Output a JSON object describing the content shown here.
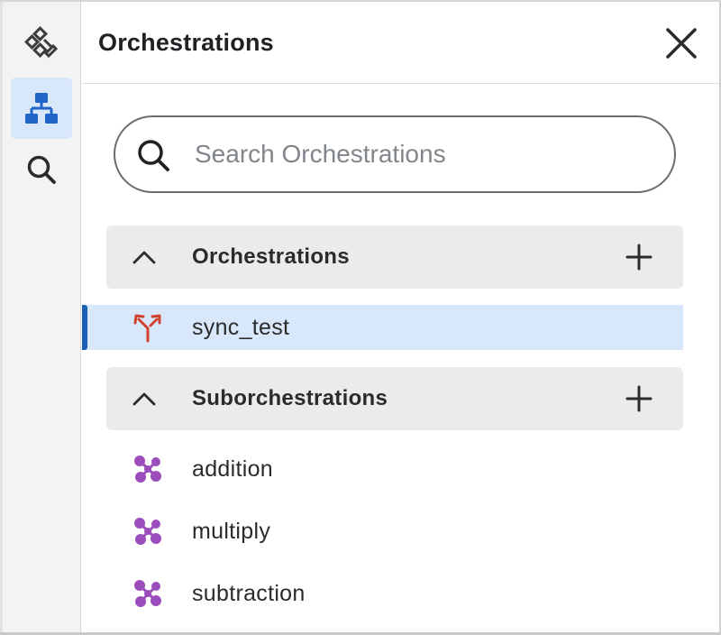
{
  "rail": {
    "items": [
      {
        "icon": "tools-icon",
        "active": false
      },
      {
        "icon": "hierarchy-icon",
        "active": true
      },
      {
        "icon": "search-icon",
        "active": false
      }
    ]
  },
  "panel": {
    "title": "Orchestrations",
    "close_icon": "close-icon"
  },
  "search": {
    "placeholder": "Search Orchestrations",
    "value": ""
  },
  "groups": [
    {
      "title": "Orchestrations",
      "expanded": true,
      "items": [
        {
          "label": "sync_test",
          "icon": "merge-arrows-icon",
          "selected": true
        }
      ]
    },
    {
      "title": "Suborchestrations",
      "expanded": true,
      "items": [
        {
          "label": "addition",
          "icon": "suborchestration-icon",
          "selected": false
        },
        {
          "label": "multiply",
          "icon": "suborchestration-icon",
          "selected": false
        },
        {
          "label": "subtraction",
          "icon": "suborchestration-icon",
          "selected": false
        }
      ]
    }
  ],
  "colors": {
    "accent": "#1a5fb4",
    "selected_bg": "#d9e7fb",
    "orchestration_icon": "#d0432f",
    "suborchestration_icon": "#9b4dbb",
    "rail_icon_active": "#1f66c8"
  }
}
